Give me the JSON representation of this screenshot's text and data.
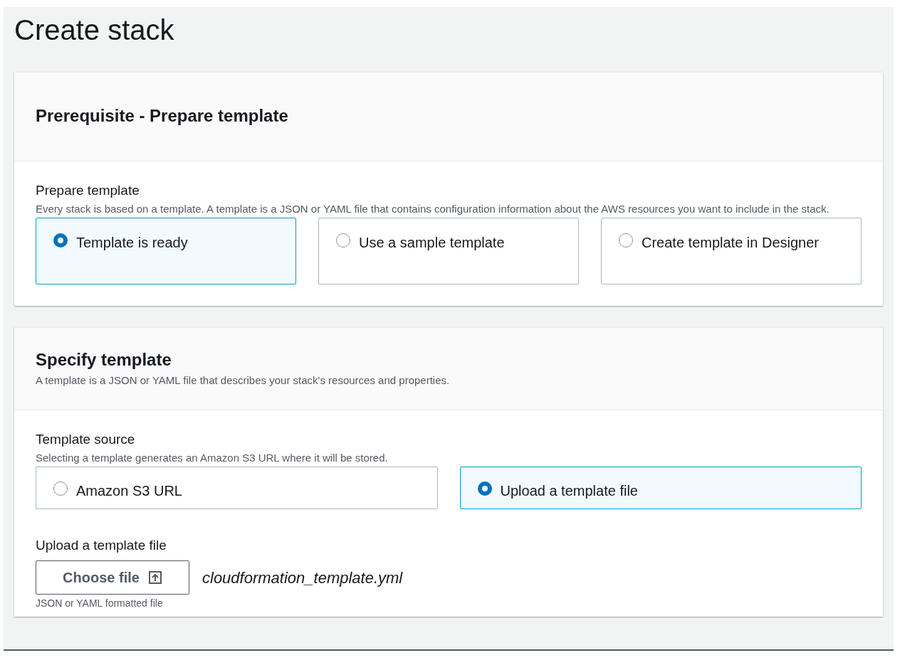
{
  "page_title": "Create stack",
  "sections": [
    {
      "title": "Prerequisite - Prepare template",
      "fields": [
        {
          "kind": "tiles",
          "label": "Prepare template",
          "description": "Every stack is based on a template. A template is a JSON or YAML file that contains configuration information about the AWS resources you want to include in the stack.",
          "options": [
            {
              "label": "Template is ready",
              "selected": true
            },
            {
              "label": "Use a sample template",
              "selected": false
            },
            {
              "label": "Create template in Designer",
              "selected": false
            }
          ]
        }
      ]
    },
    {
      "title": "Specify template",
      "description": "A template is a JSON or YAML file that describes your stack's resources and properties.",
      "fields": [
        {
          "kind": "tiles",
          "label": "Template source",
          "description": "Selecting a template generates an Amazon S3 URL where it will be stored.",
          "options": [
            {
              "label": "Amazon S3 URL",
              "selected": false
            },
            {
              "label": "Upload a template file",
              "selected": true
            }
          ]
        },
        {
          "kind": "file",
          "label": "Upload a template file",
          "button": "Choose file",
          "file_name": "cloudformation_template.yml",
          "hint": "JSON or YAML formatted file"
        }
      ]
    }
  ]
}
